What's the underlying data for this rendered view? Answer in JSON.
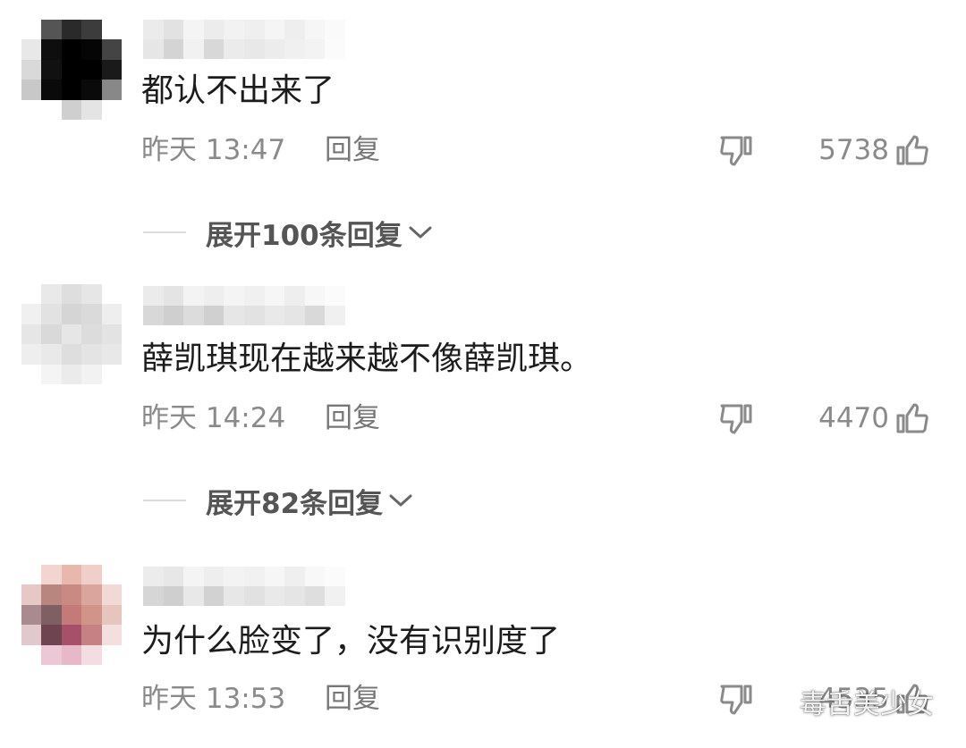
{
  "comments": [
    {
      "text": "都认不出来了",
      "time": "昨天 13:47",
      "reply_label": "回复",
      "like_count": "5738",
      "expand_label": "展开100条回复"
    },
    {
      "text": "薛凯琪现在越来越不像薛凯琪。",
      "time": "昨天 14:24",
      "reply_label": "回复",
      "like_count": "4470",
      "expand_label": "展开82条回复"
    },
    {
      "text": "为什么脸变了，没有识别度了",
      "time": "昨天 13:53",
      "reply_label": "回复",
      "like_count": "4535"
    }
  ],
  "watermark": {
    "text": "毒舌美少女"
  },
  "colors": {
    "text_primary": "#1c1c1c",
    "text_secondary": "#8a8a8a",
    "divider": "#dcdcdc"
  },
  "icons": {
    "dislike": "thumbs-down-outline-icon",
    "like": "thumbs-up-outline-icon",
    "expand": "chevron-down-icon",
    "watermark": "wechat-icon"
  }
}
